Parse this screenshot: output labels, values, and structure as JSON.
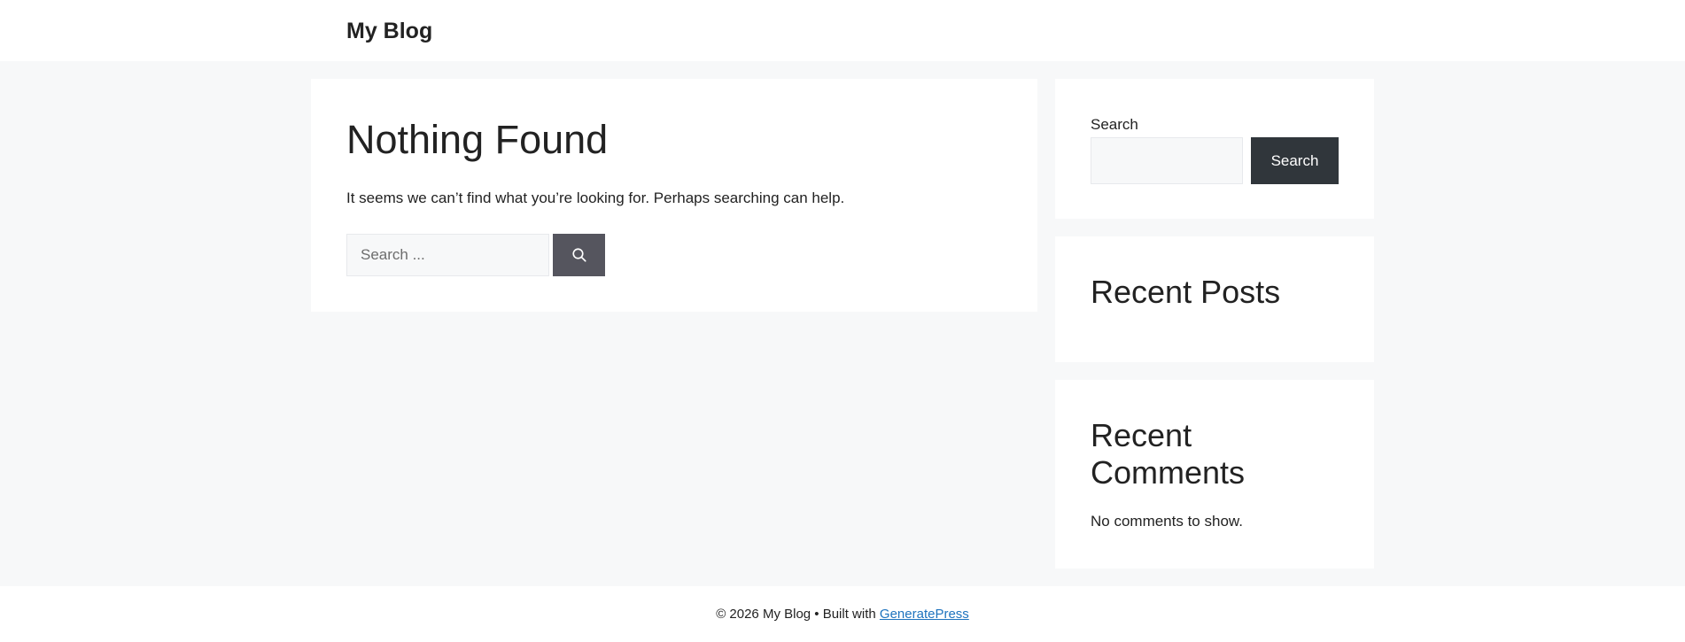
{
  "header": {
    "site_title": "My Blog"
  },
  "main": {
    "title": "Nothing Found",
    "message": "It seems we can’t find what you’re looking for. Perhaps searching can help.",
    "search_placeholder": "Search ...",
    "search_button_icon": "search-icon"
  },
  "sidebar": {
    "search_widget": {
      "label": "Search",
      "input_value": "",
      "button_label": "Search"
    },
    "recent_posts": {
      "title": "Recent Posts"
    },
    "recent_comments": {
      "title": "Recent Comments",
      "empty_text": "No comments to show."
    }
  },
  "footer": {
    "copyright": "© 2026 My Blog • Built with ",
    "link_label": "GeneratePress"
  },
  "colors": {
    "page_background": "#f7f8f9",
    "link": "#1e73be",
    "primary_button": "#30363b",
    "icon_button": "#55555e"
  }
}
